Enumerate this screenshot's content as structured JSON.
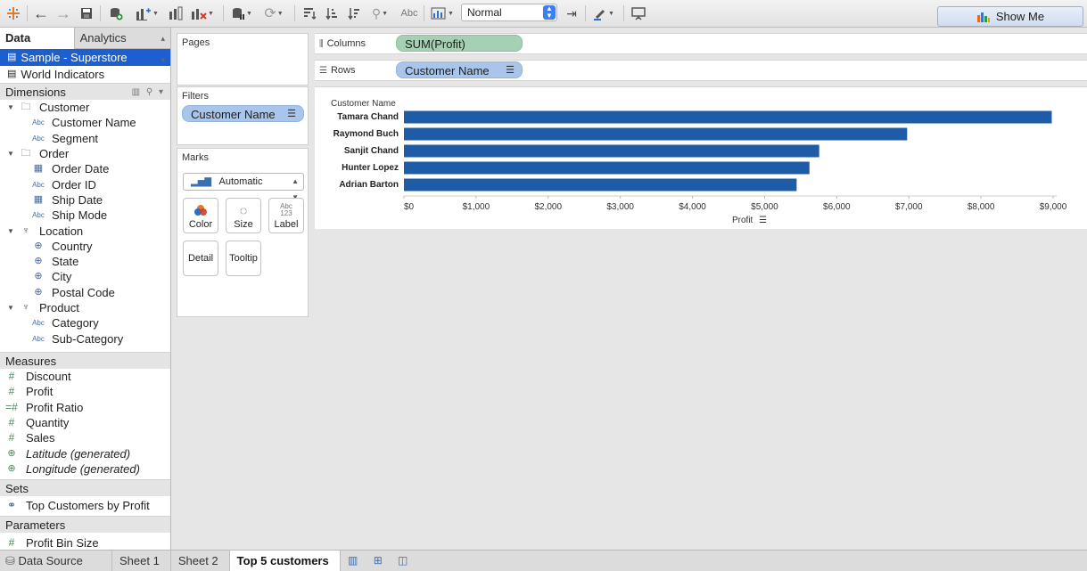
{
  "toolbar": {
    "view_mode": "Normal",
    "show_me_label": "Show Me",
    "label_toggle": "Abc"
  },
  "data_pane": {
    "tabs": [
      "Data",
      "Analytics"
    ],
    "datasources": [
      {
        "name": "Sample - Superstore",
        "selected": true
      },
      {
        "name": "World Indicators",
        "selected": false
      }
    ],
    "dimensions_header": "Dimensions",
    "dimensions": [
      {
        "label": "Customer",
        "kind": "folder",
        "icon": "folder-icon"
      },
      {
        "label": "Customer Name",
        "kind": "field",
        "icon": "abc-icon"
      },
      {
        "label": "Segment",
        "kind": "field",
        "icon": "abc-icon"
      },
      {
        "label": "Order",
        "kind": "folder",
        "icon": "folder-icon"
      },
      {
        "label": "Order Date",
        "kind": "field",
        "icon": "calendar-icon"
      },
      {
        "label": "Order ID",
        "kind": "field",
        "icon": "abc-icon"
      },
      {
        "label": "Ship Date",
        "kind": "field",
        "icon": "calendar-icon"
      },
      {
        "label": "Ship Mode",
        "kind": "field",
        "icon": "abc-icon"
      },
      {
        "label": "Location",
        "kind": "folder",
        "icon": "hierarchy-icon"
      },
      {
        "label": "Country",
        "kind": "field",
        "icon": "globe-icon"
      },
      {
        "label": "State",
        "kind": "field",
        "icon": "globe-icon"
      },
      {
        "label": "City",
        "kind": "field",
        "icon": "globe-icon"
      },
      {
        "label": "Postal Code",
        "kind": "field",
        "icon": "globe-icon"
      },
      {
        "label": "Product",
        "kind": "folder",
        "icon": "hierarchy-icon"
      },
      {
        "label": "Category",
        "kind": "field",
        "icon": "abc-icon"
      },
      {
        "label": "Sub-Category",
        "kind": "field",
        "icon": "abc-icon"
      }
    ],
    "measures_header": "Measures",
    "measures": [
      {
        "label": "Discount",
        "italic": false,
        "icon": "number-icon"
      },
      {
        "label": "Profit",
        "italic": false,
        "icon": "number-icon"
      },
      {
        "label": "Profit Ratio",
        "italic": false,
        "icon": "calculated-number-icon"
      },
      {
        "label": "Quantity",
        "italic": false,
        "icon": "number-icon"
      },
      {
        "label": "Sales",
        "italic": false,
        "icon": "number-icon"
      },
      {
        "label": "Latitude (generated)",
        "italic": true,
        "icon": "globe-icon"
      },
      {
        "label": "Longitude (generated)",
        "italic": true,
        "icon": "globe-icon"
      }
    ],
    "sets_header": "Sets",
    "sets": [
      {
        "label": "Top Customers by Profit",
        "icon": "set-icon"
      }
    ],
    "parameters_header": "Parameters",
    "parameters": [
      {
        "label": "Profit Bin Size",
        "icon": "number-icon"
      }
    ]
  },
  "cards": {
    "pages_title": "Pages",
    "filters_title": "Filters",
    "filter_pill": "Customer Name",
    "marks_title": "Marks",
    "mark_type": "Automatic",
    "mark_buttons": {
      "color": "Color",
      "size": "Size",
      "label": "Label",
      "label_icon_text": "Abc\n123",
      "detail": "Detail",
      "tooltip": "Tooltip"
    }
  },
  "shelves": {
    "columns_label": "Columns",
    "columns_pill": "SUM(Profit)",
    "rows_label": "Rows",
    "rows_pill": "Customer Name"
  },
  "chart_data": {
    "type": "bar",
    "orientation": "horizontal",
    "row_header": "Customer Name",
    "categories": [
      "Tamara Chand",
      "Raymond Buch",
      "Sanjit Chand",
      "Hunter Lopez",
      "Adrian Barton"
    ],
    "values": [
      8981,
      6976,
      5757,
      5622,
      5444
    ],
    "xlabel": "Profit",
    "xlim": [
      0,
      9000
    ],
    "ticks": [
      {
        "value": 0,
        "label": "$0"
      },
      {
        "value": 1000,
        "label": "$1,000"
      },
      {
        "value": 2000,
        "label": "$2,000"
      },
      {
        "value": 3000,
        "label": "$3,000"
      },
      {
        "value": 4000,
        "label": "$4,000"
      },
      {
        "value": 5000,
        "label": "$5,000"
      },
      {
        "value": 6000,
        "label": "$6,000"
      },
      {
        "value": 7000,
        "label": "$7,000"
      },
      {
        "value": 8000,
        "label": "$8,000"
      },
      {
        "value": 9000,
        "label": "$9,000"
      }
    ],
    "bar_color": "#1f5ca8"
  },
  "sheet_tabs": {
    "data_source": "Data Source",
    "sheets": [
      {
        "label": "Sheet 1",
        "active": false
      },
      {
        "label": "Sheet 2",
        "active": false
      },
      {
        "label": "Top 5 customers",
        "active": true
      }
    ]
  }
}
